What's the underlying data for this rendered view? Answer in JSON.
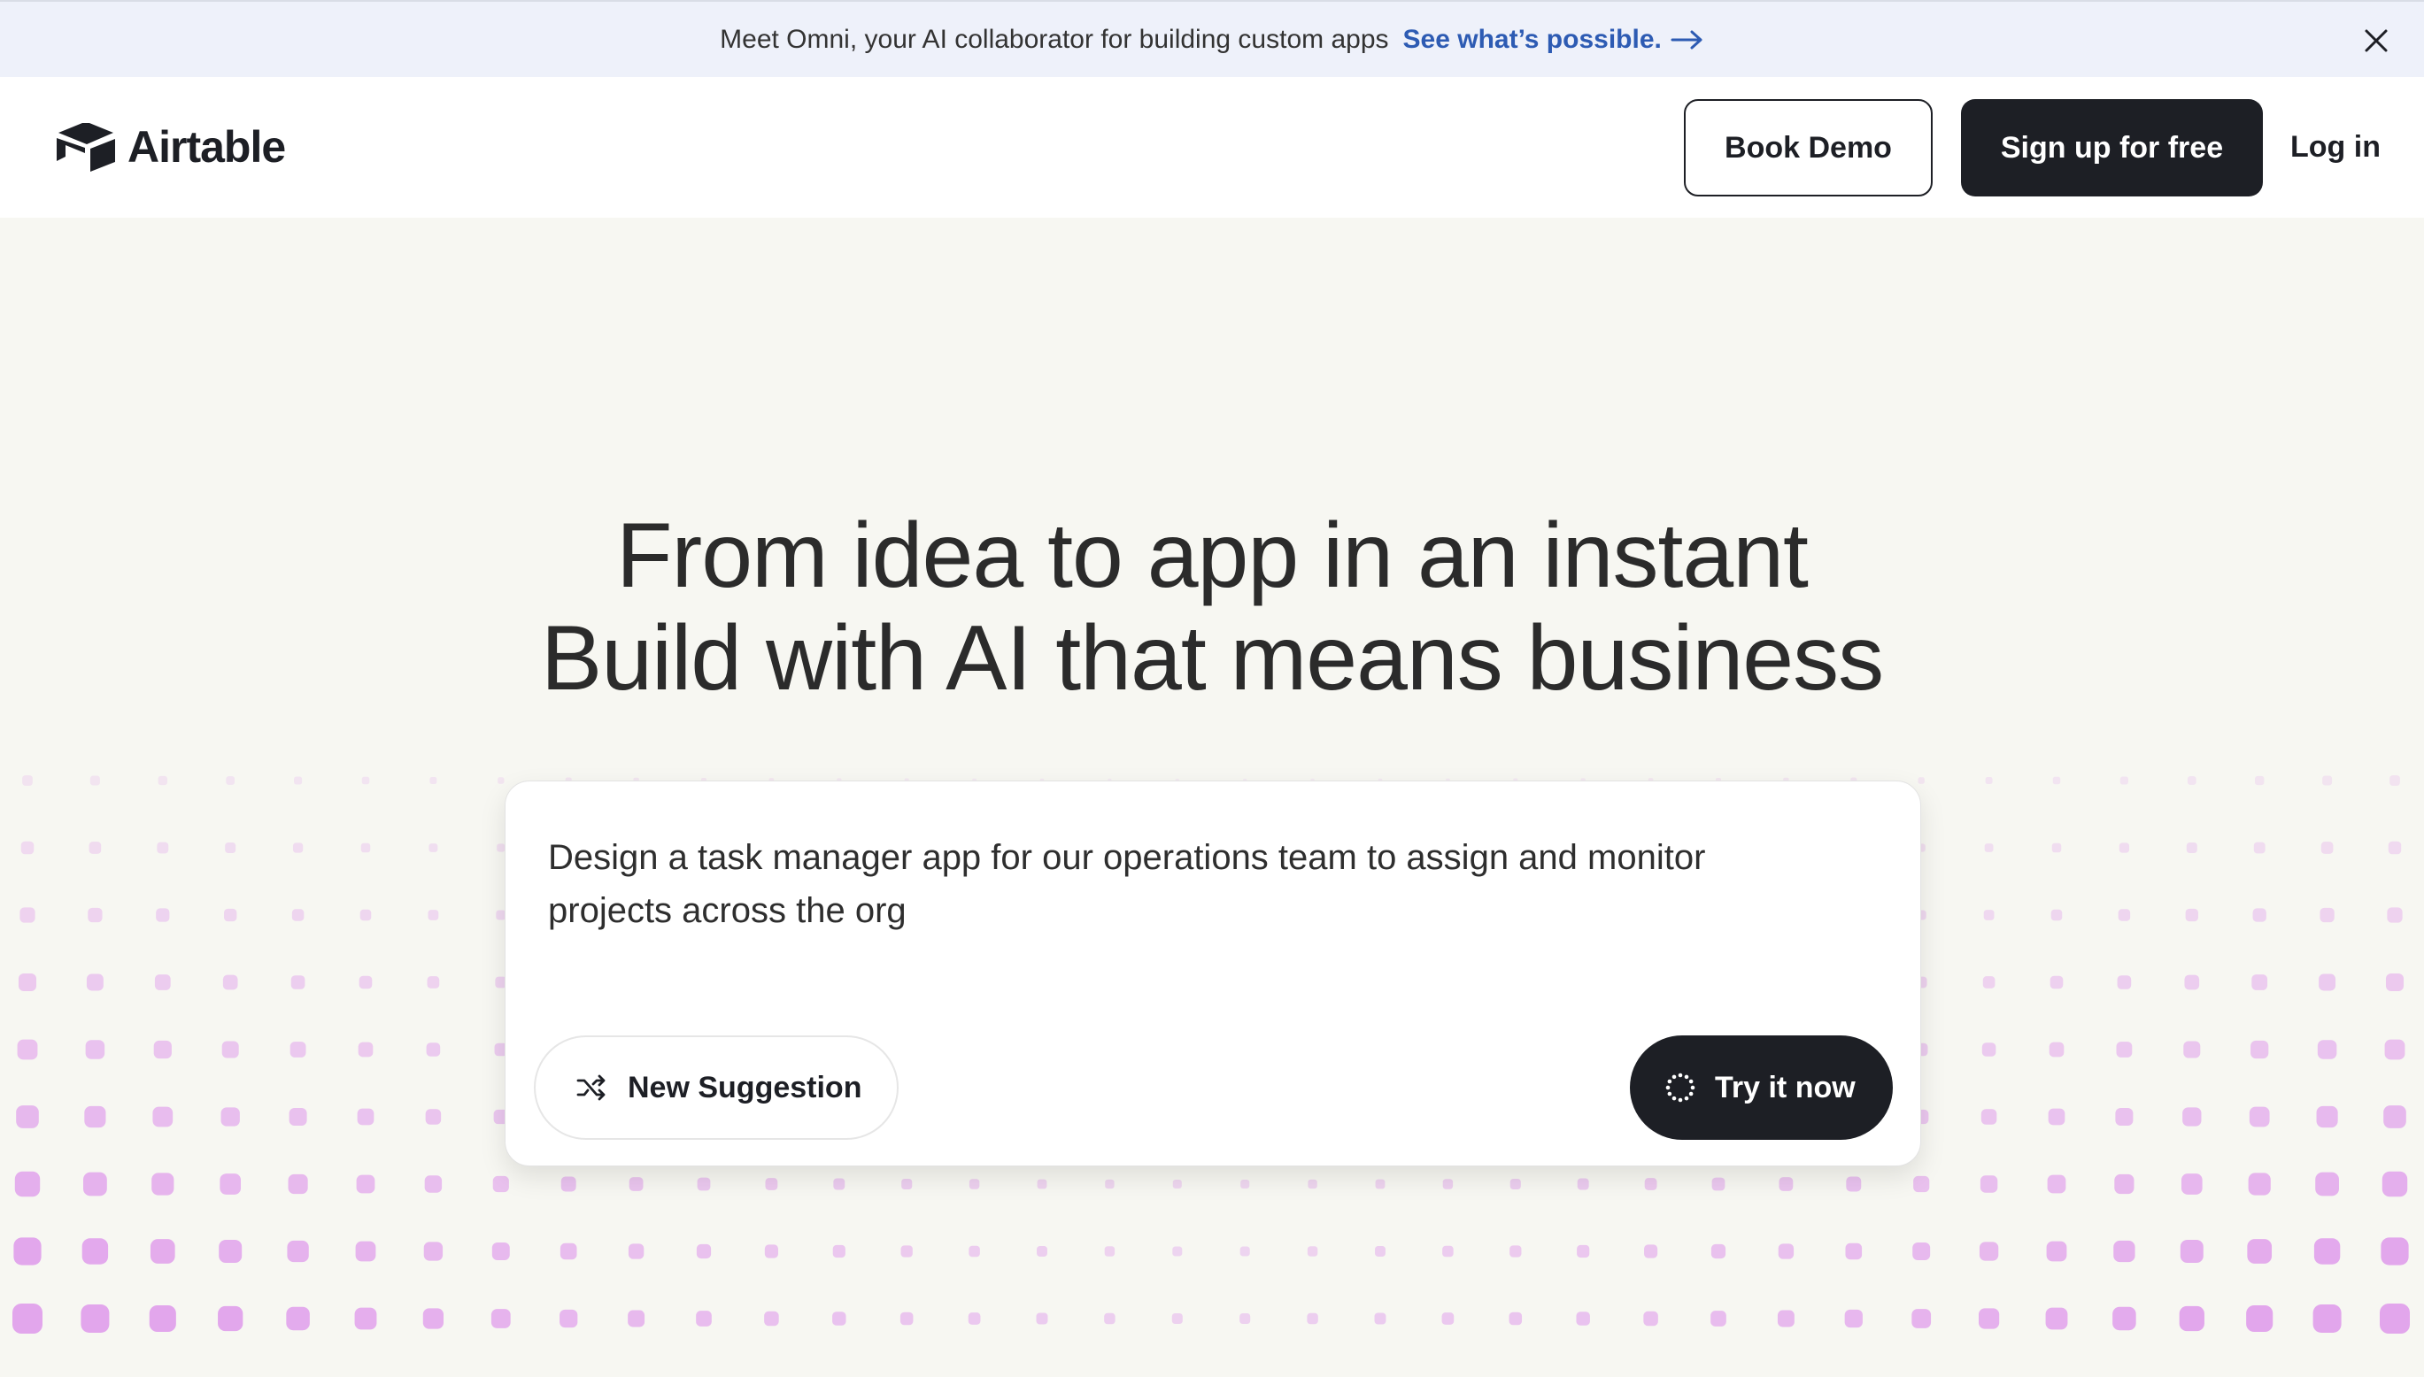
{
  "announcement": {
    "message": "Meet Omni, your AI collaborator for building custom apps",
    "link_text": "See what’s possible.",
    "icons": {
      "arrow": "arrow-right-icon",
      "close": "close-icon"
    }
  },
  "header": {
    "logo_text": "Airtable",
    "logo_icon": "airtable-logo-icon",
    "book_demo": "Book Demo",
    "sign_up": "Sign up for free",
    "log_in": "Log in"
  },
  "hero": {
    "title_line1": "From idea to app in an instant",
    "title_line2": "Build with AI that means business"
  },
  "prompt_card": {
    "text": "Design a task manager app for our operations team to assign and monitor projects across the org",
    "new_suggestion": "New Suggestion",
    "try_it_now": "Try it now",
    "icons": {
      "suggestion": "shuffle-icon",
      "try": "sparkle-loader-icon"
    }
  },
  "colors": {
    "background": "#f7f7f2",
    "announcement_bg": "#eef1fa",
    "link_blue": "#2d5bb3",
    "dark_button": "#1d1f25",
    "dot_pink": "#e2a6ec"
  }
}
